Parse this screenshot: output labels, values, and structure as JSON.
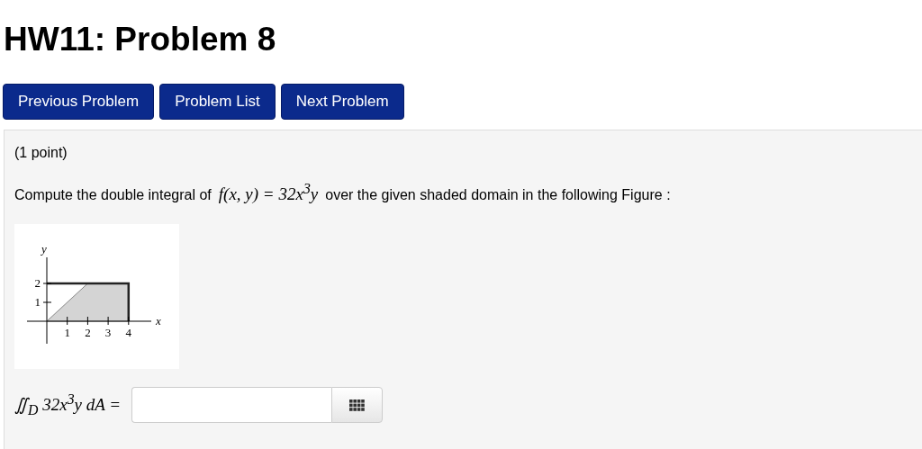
{
  "title": "HW11: Problem 8",
  "nav_buttons": [
    "Previous Problem",
    "Problem List",
    "Next Problem"
  ],
  "points": "(1 point)",
  "statement": {
    "before": "Compute the double integral of",
    "formula": "f(x, y) = 32x$^{3}$y",
    "after": "over the given shaded domain in the following Figure :"
  },
  "figure": {
    "y_label": "y",
    "x_label": "x",
    "y_ticks": [
      "2",
      "1"
    ],
    "x_ticks": [
      "1",
      "2",
      "3",
      "4"
    ]
  },
  "answer": {
    "label": "∬$_{D}$ 32x$^{3}$y dA ="
  }
}
